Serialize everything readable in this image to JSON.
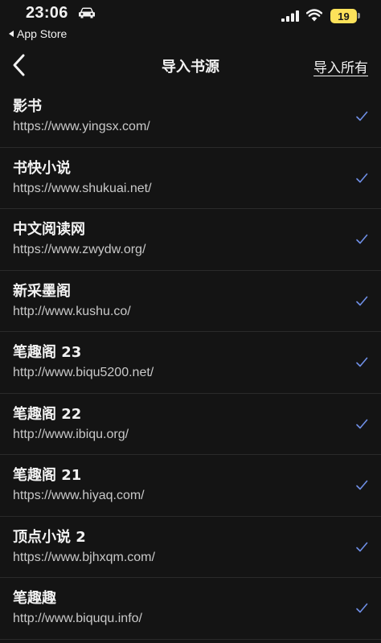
{
  "status_bar": {
    "time": "23:06",
    "back_app": "App Store",
    "battery": "19"
  },
  "nav": {
    "title": "导入书源",
    "import_all": "导入所有"
  },
  "colors": {
    "background": "#141414",
    "check": "#6f8fe6",
    "battery": "#fde25a"
  },
  "sources": [
    {
      "name": "影书",
      "url": "https://www.yingsx.com/",
      "selected": true
    },
    {
      "name": "书快小说",
      "url": "https://www.shukuai.net/",
      "selected": true
    },
    {
      "name": "中文阅读网",
      "url": "https://www.zwydw.org/",
      "selected": true
    },
    {
      "name": "新采墨阁",
      "url": "http://www.kushu.co/",
      "selected": true
    },
    {
      "name": "笔趣阁 23",
      "url": "http://www.biqu5200.net/",
      "selected": true
    },
    {
      "name": "笔趣阁 22",
      "url": "http://www.ibiqu.org/",
      "selected": true
    },
    {
      "name": "笔趣阁 21",
      "url": "https://www.hiyaq.com/",
      "selected": true
    },
    {
      "name": "顶点小说 2",
      "url": "https://www.bjhxqm.com/",
      "selected": true
    },
    {
      "name": "笔趣趣",
      "url": "http://www.biququ.info/",
      "selected": true
    }
  ]
}
